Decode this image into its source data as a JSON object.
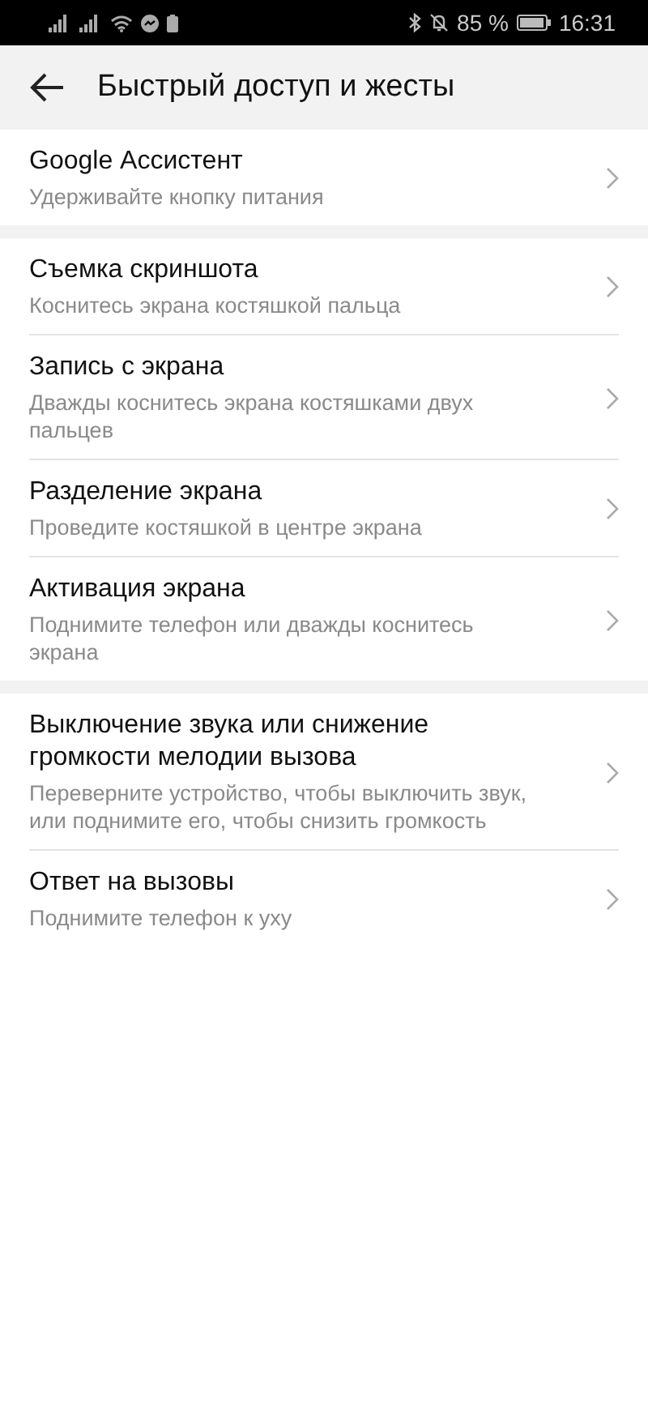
{
  "status_bar": {
    "battery": "85 %",
    "time": "16:31"
  },
  "header": {
    "title": "Быстрый доступ и жесты"
  },
  "groups": [
    {
      "items": [
        {
          "title": "Google Ассистент",
          "subtitle": "Удерживайте кнопку питания"
        }
      ]
    },
    {
      "items": [
        {
          "title": "Съемка скриншота",
          "subtitle": "Коснитесь экрана костяшкой пальца"
        },
        {
          "title": "Запись с экрана",
          "subtitle": "Дважды коснитесь экрана костяшками двух пальцев"
        },
        {
          "title": "Разделение экрана",
          "subtitle": "Проведите костяшкой в центре экрана"
        },
        {
          "title": "Активация экрана",
          "subtitle": "Поднимите телефон или дважды коснитесь экрана"
        }
      ]
    },
    {
      "items": [
        {
          "title": "Выключение звука или снижение громкости мелодии вызова",
          "subtitle": "Переверните устройство, чтобы выключить звук, или поднимите его, чтобы снизить громкость"
        },
        {
          "title": "Ответ на вызовы",
          "subtitle": "Поднимите телефон к уху"
        }
      ]
    }
  ]
}
